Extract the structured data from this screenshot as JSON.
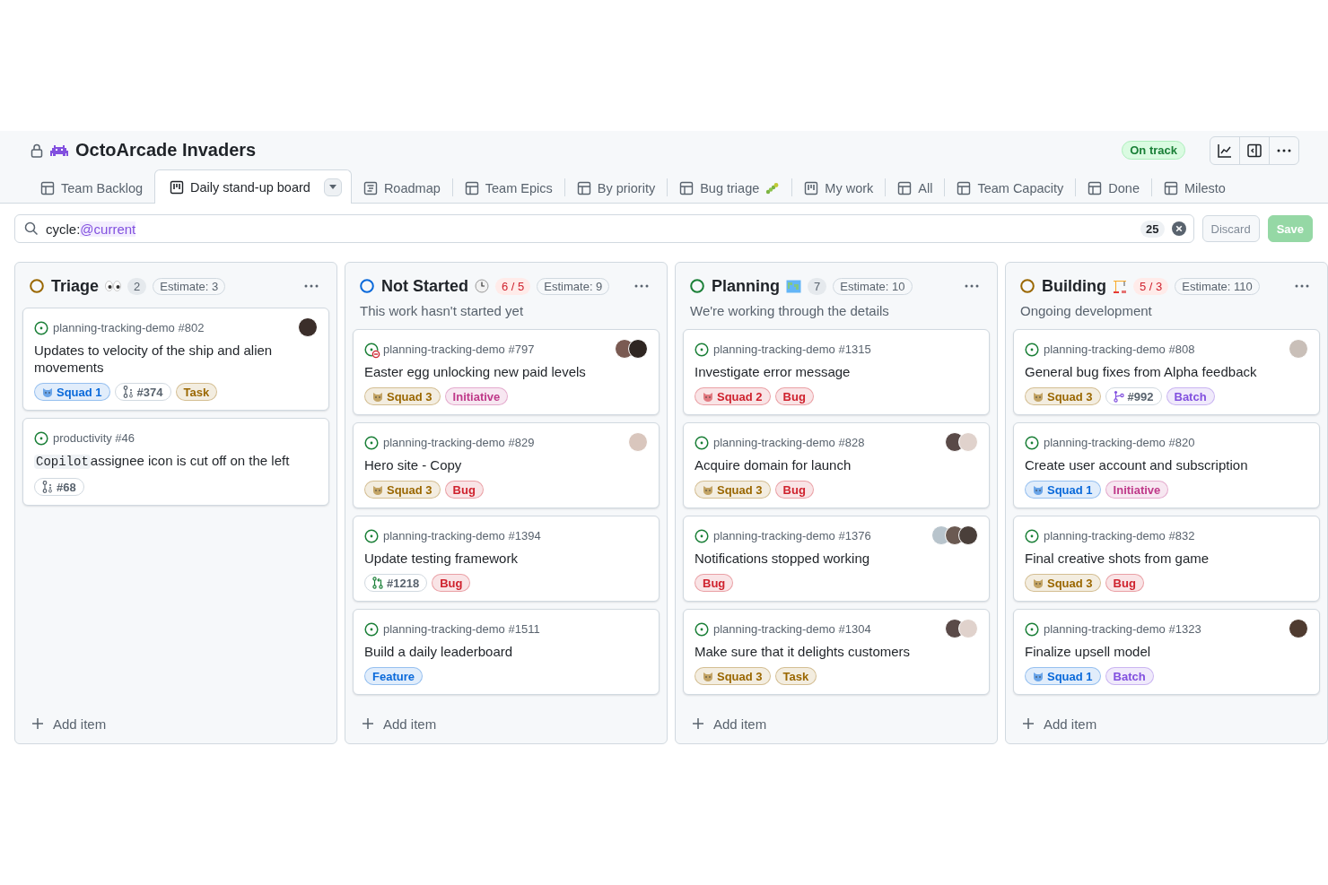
{
  "project": {
    "title": "OctoArcade Invaders",
    "private": true,
    "status": "On track"
  },
  "tabs": [
    {
      "label": "Team Backlog",
      "kind": "table",
      "selected": false
    },
    {
      "label": "Daily stand-up board",
      "kind": "board",
      "selected": true
    },
    {
      "label": "Roadmap",
      "kind": "roadmap",
      "selected": false
    },
    {
      "label": "Team Epics",
      "kind": "table",
      "selected": false
    },
    {
      "label": "By priority",
      "kind": "table",
      "selected": false
    },
    {
      "label": "Bug triage",
      "kind": "table",
      "selected": false
    },
    {
      "label": "My work",
      "kind": "board",
      "selected": false
    },
    {
      "label": "All",
      "kind": "table",
      "selected": false
    },
    {
      "label": "Team Capacity",
      "kind": "table",
      "selected": false
    },
    {
      "label": "Done",
      "kind": "table",
      "selected": false
    },
    {
      "label": "Milesto",
      "kind": "table",
      "selected": false
    }
  ],
  "filter": {
    "key": "cycle:",
    "value": "@current",
    "count": "25",
    "discard": "Discard",
    "save": "Save",
    "save_disabled": true
  },
  "columns": [
    {
      "name": "Triage",
      "color": "#9a6700",
      "count": "2",
      "over_limit": false,
      "estimate": "Estimate: 3",
      "cards": [
        {
          "repo": "planning-tracking-demo #802",
          "blocked": false,
          "assignees": [
            {
              "color": "#3b2e2a"
            }
          ],
          "title": "Updates to velocity of the ship and alien movements",
          "labels": [
            {
              "text": "Squad 1",
              "kind": "squad",
              "color": "#0969da"
            },
            {
              "text": "#374",
              "kind": "sub"
            },
            {
              "text": "Task",
              "kind": "tag",
              "color": "#9a6700"
            }
          ]
        },
        {
          "repo": "productivity #46",
          "blocked": false,
          "code": "Copilot",
          "title": "assignee icon is cut off on the left",
          "labels": [
            {
              "text": "#68",
              "kind": "sub"
            }
          ]
        }
      ],
      "add": "Add item"
    },
    {
      "name": "Not Started",
      "color": "#0969da",
      "count": "6 / 5",
      "over_limit": true,
      "estimate": "Estimate: 9",
      "description": "This work hasn't started yet",
      "cards": [
        {
          "repo": "planning-tracking-demo #797",
          "blocked": true,
          "assignees": [
            {
              "color": "#7a5a52"
            },
            {
              "color": "#2f2622"
            }
          ],
          "title": "Easter egg unlocking new paid levels",
          "labels": [
            {
              "text": "Squad 3",
              "kind": "squad",
              "color": "#9a6700"
            },
            {
              "text": "Initiative",
              "kind": "tag",
              "color": "#bf3989"
            }
          ]
        },
        {
          "repo": "planning-tracking-demo #829",
          "blocked": false,
          "assignees": [
            {
              "color": "#d9c6bd"
            }
          ],
          "title": "Hero site - Copy",
          "labels": [
            {
              "text": "Squad 3",
              "kind": "squad",
              "color": "#9a6700"
            },
            {
              "text": "Bug",
              "kind": "tag",
              "color": "#cf222e"
            }
          ]
        },
        {
          "repo": "planning-tracking-demo #1394",
          "blocked": false,
          "title": "Update testing framework",
          "labels": [
            {
              "text": "#1218",
              "kind": "pr"
            },
            {
              "text": "Bug",
              "kind": "tag",
              "color": "#cf222e"
            }
          ]
        },
        {
          "repo": "planning-tracking-demo #1511",
          "blocked": false,
          "title": "Build a daily leaderboard",
          "labels": [
            {
              "text": "Feature",
              "kind": "tag",
              "color": "#0969da"
            }
          ]
        }
      ],
      "add": "Add item"
    },
    {
      "name": "Planning",
      "color": "#1a7f37",
      "count": "7",
      "over_limit": false,
      "estimate": "Estimate: 10",
      "description": "We're working through the details",
      "cards": [
        {
          "repo": "planning-tracking-demo #1315",
          "blocked": false,
          "title": "Investigate error message",
          "labels": [
            {
              "text": "Squad 2",
              "kind": "squad",
              "color": "#cf222e"
            },
            {
              "text": "Bug",
              "kind": "tag",
              "color": "#cf222e"
            }
          ]
        },
        {
          "repo": "planning-tracking-demo #828",
          "blocked": false,
          "assignees": [
            {
              "color": "#5a4a48"
            },
            {
              "color": "#e0d2cc"
            }
          ],
          "title": "Acquire domain for launch",
          "labels": [
            {
              "text": "Squad 3",
              "kind": "squad",
              "color": "#9a6700"
            },
            {
              "text": "Bug",
              "kind": "tag",
              "color": "#cf222e"
            }
          ]
        },
        {
          "repo": "planning-tracking-demo #1376",
          "blocked": false,
          "assignees": [
            {
              "color": "#b8c4cc"
            },
            {
              "color": "#6b5a52"
            },
            {
              "color": "#4a3f3a"
            }
          ],
          "title": "Notifications stopped working",
          "labels": [
            {
              "text": "Bug",
              "kind": "tag",
              "color": "#cf222e"
            }
          ]
        },
        {
          "repo": "planning-tracking-demo #1304",
          "blocked": false,
          "assignees": [
            {
              "color": "#5a4a48"
            },
            {
              "color": "#e0d2cc"
            }
          ],
          "title": "Make sure that it delights customers",
          "labels": [
            {
              "text": "Squad 3",
              "kind": "squad",
              "color": "#9a6700"
            },
            {
              "text": "Task",
              "kind": "tag",
              "color": "#9a6700"
            }
          ]
        }
      ],
      "add": "Add item"
    },
    {
      "name": "Building",
      "color": "#9a6700",
      "count": "5 / 3",
      "over_limit": true,
      "estimate": "Estimate: 110",
      "description": "Ongoing development",
      "cards": [
        {
          "repo": "planning-tracking-demo #808",
          "blocked": false,
          "assignees": [
            {
              "color": "#c9bfb8"
            }
          ],
          "title": "General bug fixes from Alpha feedback",
          "labels": [
            {
              "text": "Squad 3",
              "kind": "squad",
              "color": "#9a6700"
            },
            {
              "text": "#992",
              "kind": "branch"
            },
            {
              "text": "Batch",
              "kind": "tag",
              "color": "#8250df"
            }
          ]
        },
        {
          "repo": "planning-tracking-demo #820",
          "blocked": false,
          "title": "Create user account and subscription",
          "labels": [
            {
              "text": "Squad 1",
              "kind": "squad",
              "color": "#0969da"
            },
            {
              "text": "Initiative",
              "kind": "tag",
              "color": "#bf3989"
            }
          ]
        },
        {
          "repo": "planning-tracking-demo #832",
          "blocked": false,
          "title": "Final creative shots from game",
          "labels": [
            {
              "text": "Squad 3",
              "kind": "squad",
              "color": "#9a6700"
            },
            {
              "text": "Bug",
              "kind": "tag",
              "color": "#cf222e"
            }
          ]
        },
        {
          "repo": "planning-tracking-demo #1323",
          "blocked": false,
          "assignees": [
            {
              "color": "#4f3b30"
            }
          ],
          "title": "Finalize upsell model",
          "labels": [
            {
              "text": "Squad 1",
              "kind": "squad",
              "color": "#0969da"
            },
            {
              "text": "Batch",
              "kind": "tag",
              "color": "#8250df"
            }
          ]
        }
      ],
      "add": "Add item"
    }
  ]
}
